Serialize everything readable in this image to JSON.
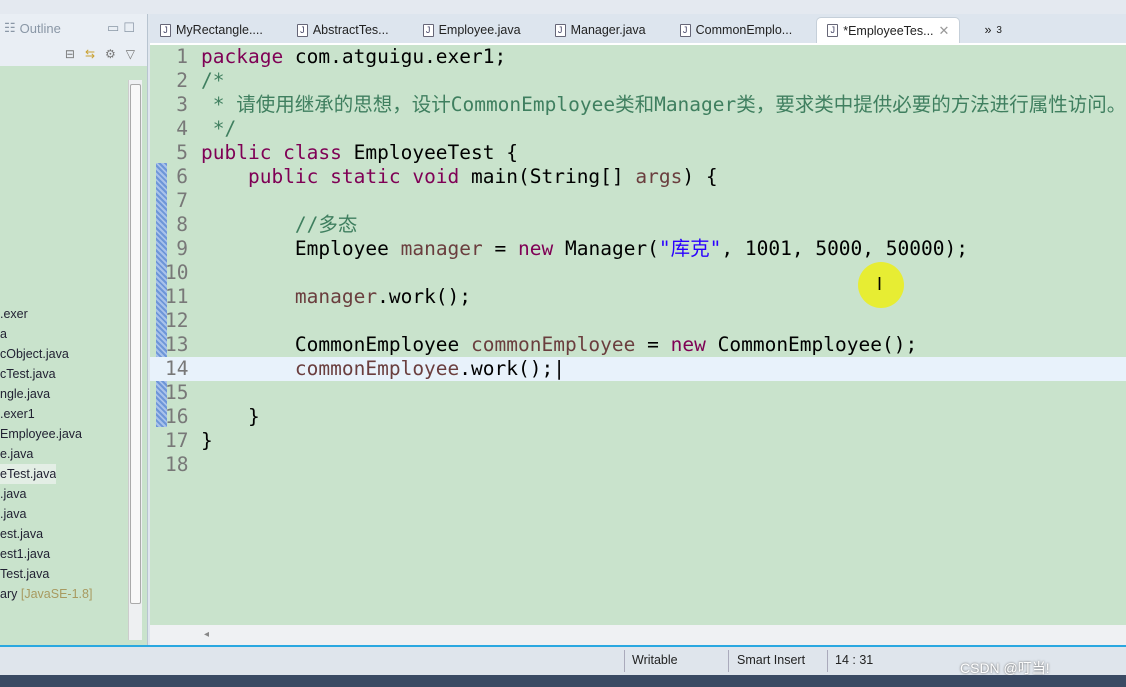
{
  "outline_panel": {
    "title": "Outline"
  },
  "tree": {
    "items": [
      ".exer",
      "a",
      "cObject.java",
      "cTest.java",
      "ngle.java",
      ".exer1",
      "Employee.java",
      "e.java",
      "eTest.java",
      ".java",
      ".java",
      "est.java",
      "est1.java",
      "Test.java",
      "ary"
    ],
    "library_suffix": "[JavaSE-1.8]"
  },
  "tabs": [
    {
      "label": "MyRectangle...."
    },
    {
      "label": "AbstractTes..."
    },
    {
      "label": "Employee.java"
    },
    {
      "label": "Manager.java"
    },
    {
      "label": "CommonEmplo..."
    },
    {
      "label": "*EmployeeTes...",
      "active": true
    }
  ],
  "tabs_overflow": {
    "label": "»",
    "count": "3"
  },
  "editor": {
    "current_line": 14,
    "lines": [
      [
        [
          "kw",
          "package"
        ],
        [
          "pl",
          " com.atguigu.exer1;"
        ]
      ],
      [
        [
          "cm",
          "/*"
        ]
      ],
      [
        [
          "cm",
          " * 请使用继承的思想，设计CommonEmployee类和Manager类，要求类中提供必要的方法进行属性访问。"
        ]
      ],
      [
        [
          "cm",
          " */"
        ]
      ],
      [
        [
          "kw",
          "public class"
        ],
        [
          "pl",
          " EmployeeTest {"
        ]
      ],
      [
        [
          "pl",
          "    "
        ],
        [
          "kw",
          "public static void"
        ],
        [
          "pl",
          " main(String[] "
        ],
        [
          "var",
          "args"
        ],
        [
          "pl",
          ") {"
        ]
      ],
      [],
      [
        [
          "pl",
          "        "
        ],
        [
          "cm",
          "//多态"
        ]
      ],
      [
        [
          "pl",
          "        Employee "
        ],
        [
          "var",
          "manager"
        ],
        [
          "pl",
          " = "
        ],
        [
          "kw",
          "new"
        ],
        [
          "pl",
          " Manager("
        ],
        [
          "st",
          "\"库克\""
        ],
        [
          "pl",
          ", 1001, 5000, 50000);"
        ]
      ],
      [],
      [
        [
          "pl",
          "        "
        ],
        [
          "var",
          "manager"
        ],
        [
          "pl",
          ".work();"
        ]
      ],
      [],
      [
        [
          "pl",
          "        CommonEmployee "
        ],
        [
          "var",
          "commonEmployee"
        ],
        [
          "pl",
          " = "
        ],
        [
          "kw",
          "new"
        ],
        [
          "pl",
          " CommonEmployee();"
        ]
      ],
      [
        [
          "pl",
          "        "
        ],
        [
          "var",
          "commonEmployee"
        ],
        [
          "pl",
          ".work();|"
        ]
      ],
      [],
      [
        [
          "pl",
          "    }"
        ]
      ],
      [
        [
          "pl",
          "}"
        ]
      ],
      []
    ]
  },
  "status": {
    "writable": "Writable",
    "insert_mode": "Smart Insert",
    "position": "14 : 31"
  },
  "watermark": "CSDN @叮当!"
}
